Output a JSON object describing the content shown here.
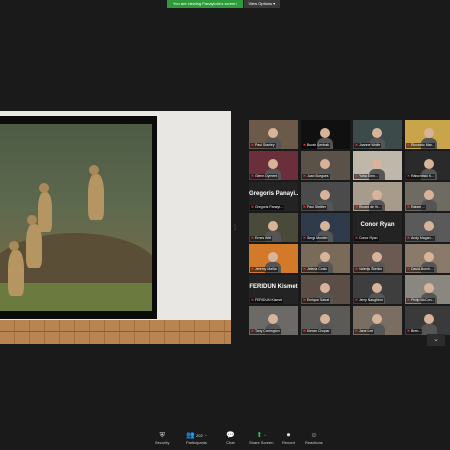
{
  "banner": {
    "message": "You are viewing Panayiotis's screen",
    "options_label": "View Options",
    "options_caret": "▾"
  },
  "grid": {
    "tiles": [
      {
        "name": "Paul Stanley",
        "type": "video",
        "bg": "#6b5a4a",
        "muted": true
      },
      {
        "name": "Burak Şenbak",
        "type": "video",
        "bg": "#101010",
        "muted": true
      },
      {
        "name": "Joanne Wolfe",
        "type": "video",
        "bg": "#3d4a4a",
        "muted": true
      },
      {
        "name": "Riccardo Mar...",
        "type": "video",
        "bg": "#c9a44a",
        "muted": true
      },
      {
        "name": "Glenn Dyment",
        "type": "video",
        "bg": "#6a2f3a",
        "muted": true
      },
      {
        "name": "Juan Burgues",
        "type": "video",
        "bg": "#5a5248",
        "muted": true
      },
      {
        "name": "Yoha Sinn...",
        "type": "video",
        "bg": "#bfb7aa",
        "muted": true
      },
      {
        "name": "Ratschitski K...",
        "type": "video",
        "bg": "#2a2a2a",
        "muted": true
      },
      {
        "name": "Gregoris Panayi...",
        "type": "name",
        "muted": true
      },
      {
        "name": "Paul Stettler",
        "type": "video",
        "bg": "#4b4b4b",
        "muted": true
      },
      {
        "name": "Ricard de Vr...",
        "type": "video",
        "bg": "#a79c8c",
        "muted": true
      },
      {
        "name": "Rafael ...",
        "type": "video",
        "bg": "#6f6b63",
        "muted": true
      },
      {
        "name": "Ernes Witt",
        "type": "video",
        "bg": "#4a4a3a",
        "muted": true
      },
      {
        "name": "Sergi Montiel",
        "type": "video",
        "bg": "#2f3a4a",
        "muted": true
      },
      {
        "name": "Conor Ryan",
        "type": "name",
        "muted": true
      },
      {
        "name": "Andy Magan...",
        "type": "video",
        "bg": "#5a5a5a",
        "muted": true
      },
      {
        "name": "Jeremy Mallia",
        "type": "video",
        "bg": "#d27a2a",
        "muted": true
      },
      {
        "name": "Jelena Cosic",
        "type": "video",
        "bg": "#7a6a5a",
        "muted": true
      },
      {
        "name": "Valerijs Šileikis",
        "type": "video",
        "bg": "#6a5a52",
        "muted": true
      },
      {
        "name": "David Burch...",
        "type": "video",
        "bg": "#8a7a6a",
        "muted": true
      },
      {
        "name": "FERIDUN Kismet",
        "type": "name",
        "muted": true
      },
      {
        "name": "Enrique Sabat",
        "type": "video",
        "bg": "#5a4e46",
        "muted": true
      },
      {
        "name": "Jerry Naughton",
        "type": "video",
        "bg": "#3e3e3e",
        "muted": true
      },
      {
        "name": "Philip McCon...",
        "type": "video",
        "bg": "#8a8680",
        "muted": true
      },
      {
        "name": "Tony Carrington",
        "type": "video",
        "bg": "#6c6a66",
        "muted": true
      },
      {
        "name": "Kieran Chopar",
        "type": "video",
        "bg": "#5c5a56",
        "muted": true
      },
      {
        "name": "Jane Lee",
        "type": "video",
        "bg": "#7a6e62",
        "muted": true
      },
      {
        "name": "Bren...",
        "type": "video",
        "bg": "#3a3a3a",
        "muted": true
      }
    ]
  },
  "toolbar": {
    "security": "Security",
    "participants": "Participants",
    "participants_count": "202",
    "chat": "Chat",
    "share_screen": "Share Screen",
    "record": "Record",
    "reactions": "Reactions"
  },
  "icons": {
    "security": "shield-icon",
    "participants": "people-icon",
    "chat": "chat-bubble-icon",
    "share": "share-up-arrow-icon",
    "record": "record-dot-icon",
    "reactions": "emoji-plus-icon",
    "mic_muted": "mic-muted-icon"
  },
  "colors": {
    "accent_green": "#27c24c",
    "banner_green": "#2d9b3a",
    "muted_red": "#e23a3a"
  }
}
